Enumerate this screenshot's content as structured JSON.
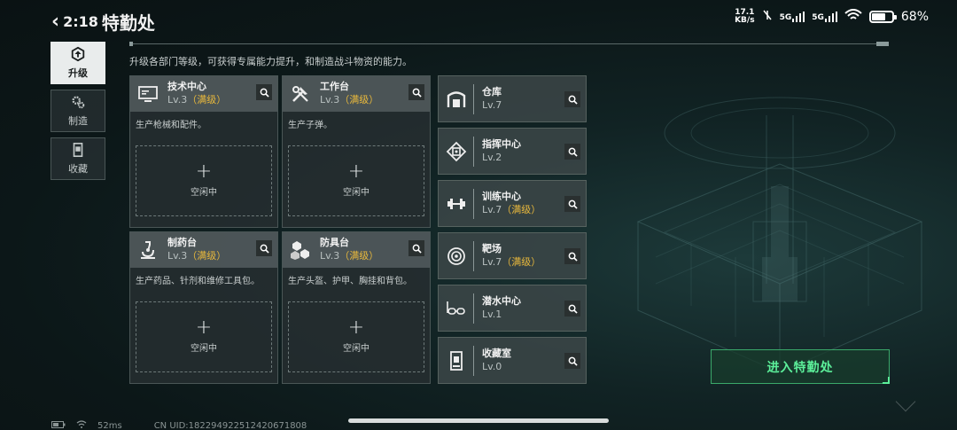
{
  "status_bar": {
    "time": "2:18",
    "net_speed_value": "17.1",
    "net_speed_unit": "KB/s",
    "signal_1": "5G",
    "signal_2": "5G",
    "battery_percent": "68%",
    "battery_level": 0.68
  },
  "header": {
    "title": "特勤处",
    "subtitle": "升级各部门等级，可获得专属能力提升，和制造战斗物资的能力。"
  },
  "nav": {
    "items": [
      {
        "label": "升级",
        "icon": "upgrade-icon",
        "active": true
      },
      {
        "label": "制造",
        "icon": "gears-icon",
        "active": false
      },
      {
        "label": "收藏",
        "icon": "collection-icon",
        "active": false
      }
    ]
  },
  "cards": [
    {
      "name": "技术中心",
      "level": "Lv.3",
      "maxed": "（满级）",
      "desc": "生产枪械和配件。",
      "slot_plus": "+",
      "slot_label": "空闲中",
      "icon": "computer-icon"
    },
    {
      "name": "工作台",
      "level": "Lv.3",
      "maxed": "（满级）",
      "desc": "生产子弹。",
      "slot_plus": "+",
      "slot_label": "空闲中",
      "icon": "tools-icon"
    },
    {
      "name": "制药台",
      "level": "Lv.3",
      "maxed": "（满级）",
      "desc": "生产药品、针剂和维修工具包。",
      "slot_plus": "+",
      "slot_label": "空闲中",
      "icon": "microscope-icon"
    },
    {
      "name": "防具台",
      "level": "Lv.3",
      "maxed": "（满级）",
      "desc": "生产头盔、护甲、胸挂和背包。",
      "slot_plus": "+",
      "slot_label": "空闲中",
      "icon": "cubes-icon"
    }
  ],
  "departments": [
    {
      "name": "仓库",
      "level": "Lv.7",
      "maxed": "",
      "icon": "warehouse-icon"
    },
    {
      "name": "指挥中心",
      "level": "Lv.2",
      "maxed": "",
      "icon": "chip-icon"
    },
    {
      "name": "训练中心",
      "level": "Lv.7",
      "maxed": "（满级）",
      "icon": "dumbbell-icon"
    },
    {
      "name": "靶场",
      "level": "Lv.7",
      "maxed": "（满级）",
      "icon": "target-icon"
    },
    {
      "name": "潜水中心",
      "level": "Lv.1",
      "maxed": "",
      "icon": "goggles-icon"
    },
    {
      "name": "收藏室",
      "level": "Lv.0",
      "maxed": "",
      "icon": "display-case-icon"
    }
  ],
  "enter_button": "进入特勤处",
  "footer": {
    "ping": "52ms",
    "uid": "CN UID:18229492251242067180​8"
  }
}
